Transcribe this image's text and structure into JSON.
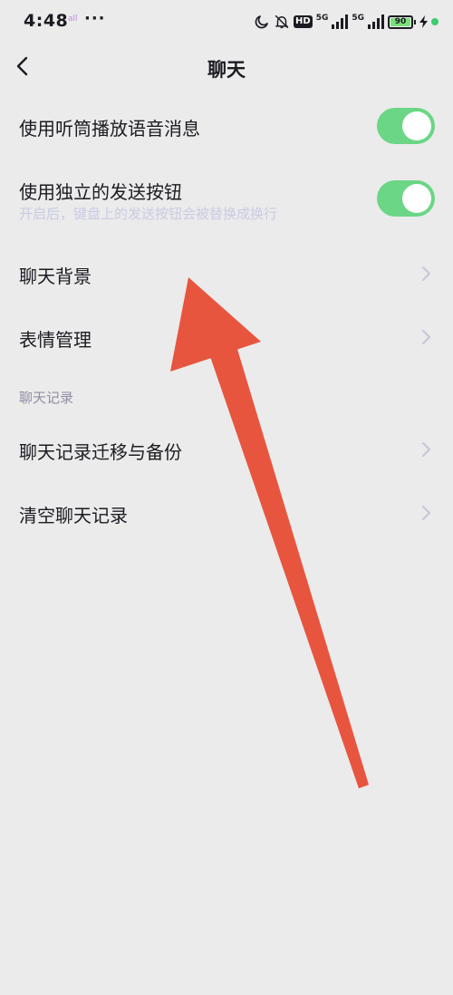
{
  "status": {
    "time": "4:48",
    "app_icon": "all",
    "more": "···",
    "hd": "HD",
    "net1": "5G",
    "net2": "5G",
    "battery": "90",
    "battery_level": 0.9,
    "icons": [
      "moon-icon",
      "bell-muted-icon",
      "signal-icon",
      "charging-icon"
    ]
  },
  "header": {
    "title": "聊天",
    "back_icon": "chevron-left-icon"
  },
  "settings": {
    "earpiece": {
      "label": "使用听筒播放语音消息",
      "enabled": true
    },
    "separate_send": {
      "label": "使用独立的发送按钮",
      "sub": "开启后，键盘上的发送按钮会被替换成换行",
      "enabled": true
    },
    "chat_background": {
      "label": "聊天背景"
    },
    "sticker_manage": {
      "label": "表情管理"
    },
    "history_section": "聊天记录",
    "migrate_backup": {
      "label": "聊天记录迁移与备份"
    },
    "clear_history": {
      "label": "清空聊天记录"
    }
  },
  "colors": {
    "background": "#ebebeb",
    "toggle_on": "#6bd685",
    "annotation_arrow": "#e8553f"
  }
}
